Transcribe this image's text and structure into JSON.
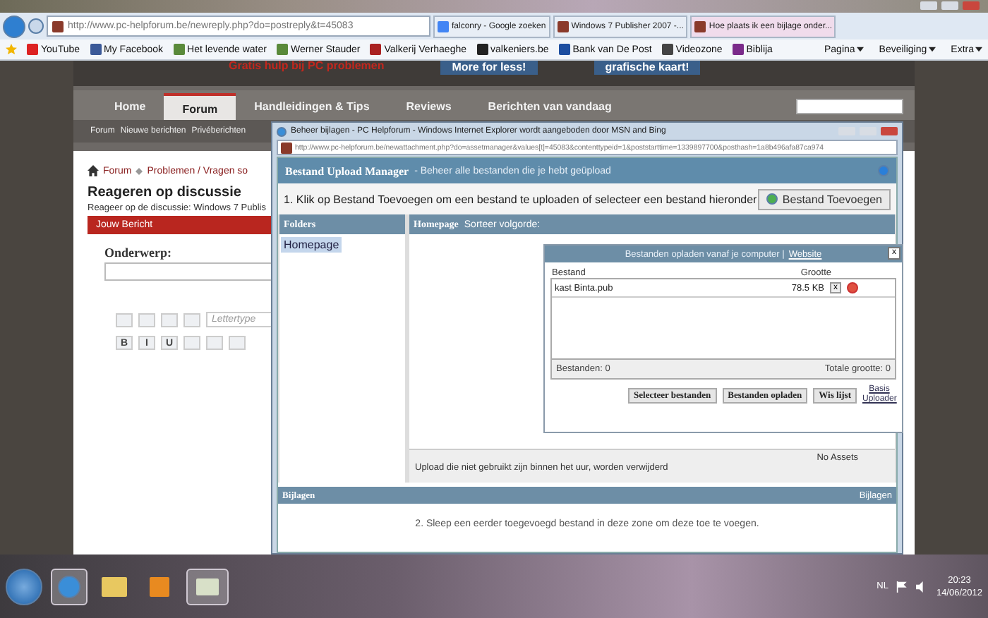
{
  "browser": {
    "address": "http://www.pc-helpforum.be/newreply.php?do=postreply&t=45083",
    "tabs": [
      {
        "title": "falconry - Google zoeken",
        "selected": false
      },
      {
        "title": "Windows 7 Publisher 2007 -...",
        "selected": false
      },
      {
        "title": "Hoe plaats ik een bijlage onder...",
        "selected": true
      }
    ],
    "favorites": [
      "YouTube",
      "My Facebook",
      "Het levende water",
      "Werner Stauder",
      "Valkerij Verhaeghe",
      "valkeniers.be",
      "Bank van De Post",
      "Videozone",
      "Biblija"
    ],
    "commands": [
      "Pagina",
      "Beveiliging",
      "Extra"
    ]
  },
  "site": {
    "tagline": "Gratis hulp bij PC problemen",
    "ads": [
      "More for less!",
      "grafische kaart!"
    ],
    "nav": [
      {
        "label": "Home",
        "selected": false
      },
      {
        "label": "Forum",
        "selected": true
      },
      {
        "label": "Handleidingen & Tips",
        "selected": false
      },
      {
        "label": "Reviews",
        "selected": false
      },
      {
        "label": "Berichten van vandaag",
        "selected": false
      }
    ],
    "subnav": [
      "Forum",
      "Nieuwe berichten",
      "Privéberichten"
    ],
    "breadcrumb": [
      "Forum",
      "Problemen / Vragen so"
    ],
    "title": "Reageren op discussie",
    "subtitle": "Reageer op de discussie: Windows 7 Publis",
    "section": "Jouw Bericht",
    "subject_label": "Onderwerp:",
    "font_placeholder": "Lettertype",
    "format_buttons": [
      "B",
      "I",
      "U"
    ]
  },
  "popup": {
    "title": "Beheer bijlagen - PC Helpforum - Windows Internet Explorer wordt aangeboden door MSN and Bing",
    "address": "http://www.pc-helpforum.be/newattachment.php?do=assetmanager&values[t]=45083&contenttypeid=1&poststarttime=1339897700&posthash=1a8b496afa87ca974",
    "manager_title": "Bestand Upload Manager",
    "manager_subtitle": "- Beheer alle bestanden die je hebt geüpload",
    "instruction": "1. Klik op Bestand Toevoegen om een bestand te uploaden of selecteer een bestand hieronder",
    "add_button": "Bestand Toevoegen",
    "folders_title": "Folders",
    "folders": [
      {
        "label": "Homepage",
        "selected": true
      }
    ],
    "files_title": "Homepage",
    "sort_label": "Sorteer volgorde:",
    "no_assets": "No Assets",
    "footer_note": "Upload die niet gebruikt zijn binnen het uur, worden verwijderd",
    "upload": {
      "title": "Bestanden opladen vanaf je computer |",
      "link": "Website",
      "close": "x",
      "columns": [
        "Bestand",
        "Grootte"
      ],
      "files": [
        {
          "name": "kast Binta.pub",
          "size": "78.5 KB",
          "remove": "x"
        }
      ],
      "count": "Bestanden: 0",
      "total": "Totale grootte: 0",
      "buttons": [
        "Selecteer bestanden",
        "Bestanden opladen",
        "Wis lijst"
      ],
      "basic_link": "Basis Uploader"
    },
    "attachments_left": "Bijlagen",
    "attachments_right": "Bijlagen",
    "drop_text": "2. Sleep een eerder toegevoegd bestand in deze zone om deze toe te voegen."
  },
  "taskbar": {
    "language": "NL",
    "time": "20:23",
    "date": "14/06/2012"
  }
}
